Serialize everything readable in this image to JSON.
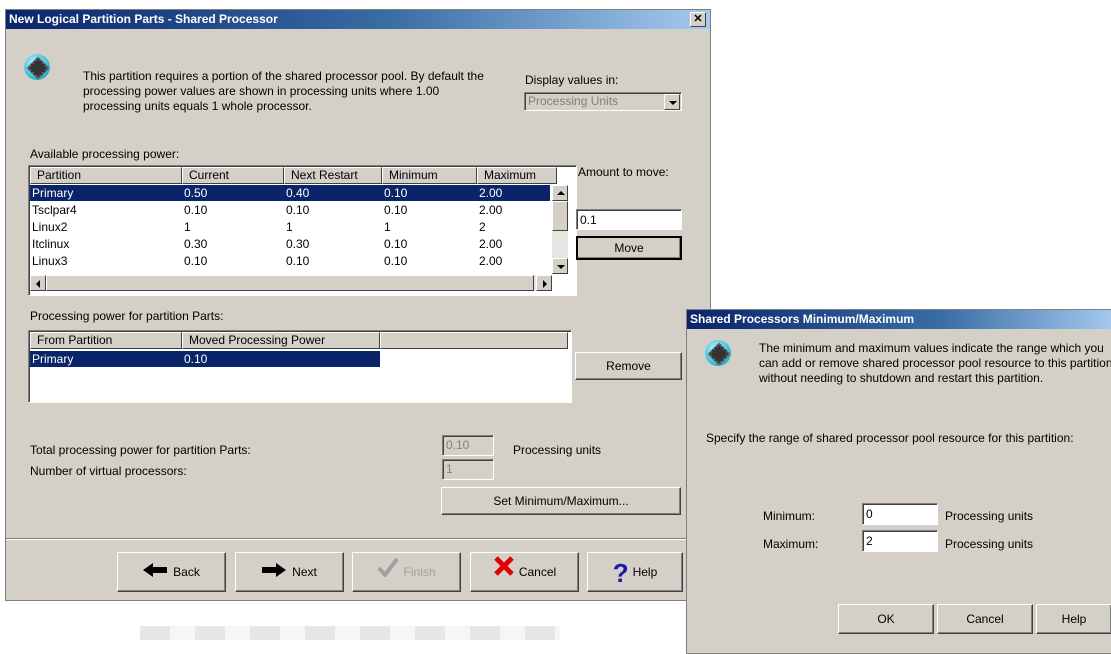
{
  "main": {
    "title": "New Logical Partition Parts - Shared Processor",
    "close_glyph": "✕",
    "intro": "This partition requires a portion of the shared processor pool.  By default the processing power values are shown in processing units where 1.00 processing units equals 1 whole processor.",
    "display_values_label": "Display values in:",
    "display_values_selected": "Processing Units",
    "available_label": "Available processing power:",
    "available_columns": [
      "Partition",
      "Current",
      "Next Restart",
      "Minimum",
      "Maximum"
    ],
    "available_rows": [
      [
        "Primary",
        "0.50",
        "0.40",
        "0.10",
        "2.00"
      ],
      [
        "Tsclpar4",
        "0.10",
        "0.10",
        "0.10",
        "2.00"
      ],
      [
        "Linux2",
        "1",
        "1",
        "1",
        "2"
      ],
      [
        "Itclinux",
        "0.30",
        "0.30",
        "0.10",
        "2.00"
      ],
      [
        "Linux3",
        "0.10",
        "0.10",
        "0.10",
        "2.00"
      ]
    ],
    "amount_label": "Amount to move:",
    "amount_value": "0.1",
    "move_button": "Move",
    "processing_label": "Processing power for partition Parts:",
    "processing_columns": [
      "From Partition",
      "Moved Processing Power"
    ],
    "processing_rows": [
      [
        "Primary",
        "0.10"
      ]
    ],
    "remove_button": "Remove",
    "total_label": "Total processing power for partition Parts:",
    "total_value": "0.10",
    "total_unit": "Processing units",
    "virtual_label": "Number of virtual processors:",
    "virtual_value": "1",
    "set_minmax_button": "Set Minimum/Maximum...",
    "back_button": "Back",
    "next_button": "Next",
    "finish_button": "Finish",
    "cancel_button": "Cancel",
    "help_button": "Help"
  },
  "dialog": {
    "title": "Shared Processors Minimum/Maximum",
    "intro": "The minimum and maximum values indicate the range which you can add or remove shared processor pool resource to this partition without needing to shutdown and restart this partition.",
    "specify": "Specify the range of shared processor pool resource for this partition:",
    "minimum_label": "Minimum:",
    "minimum_value": "0",
    "maximum_label": "Maximum:",
    "maximum_value": "2",
    "unit": "Processing units",
    "ok_button": "OK",
    "cancel_button": "Cancel",
    "help_button": "Help"
  },
  "colors": {
    "selection": "#0a246a",
    "title_gradient_start": "#0a246a",
    "cancel_x": "#e00000",
    "help_q": "#1a1aa8"
  }
}
